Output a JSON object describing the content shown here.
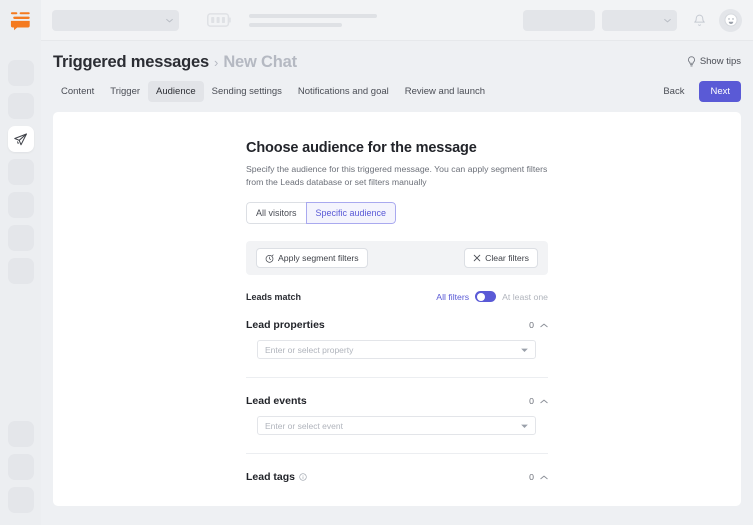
{
  "colors": {
    "accent": "#5a5ad6",
    "brand_orange": "#f47a20",
    "page_bg": "#eef0f3",
    "card_bg": "#ffffff",
    "muted_text": "#b0b4bc"
  },
  "rail": {
    "logo_name": "dashly-logo",
    "items": [
      {
        "name": "sidebar-item-skeleton-1",
        "state": "placeholder"
      },
      {
        "name": "sidebar-item-skeleton-2",
        "state": "placeholder"
      },
      {
        "name": "sidebar-item-triggered-messages",
        "state": "active",
        "icon": "paper-plane-icon"
      },
      {
        "name": "sidebar-item-skeleton-3",
        "state": "placeholder"
      },
      {
        "name": "sidebar-item-skeleton-4",
        "state": "placeholder"
      },
      {
        "name": "sidebar-item-skeleton-5",
        "state": "placeholder"
      },
      {
        "name": "sidebar-item-skeleton-6",
        "state": "placeholder"
      }
    ],
    "bottom_items": [
      {
        "name": "sidebar-bottom-skeleton-1",
        "state": "placeholder"
      },
      {
        "name": "sidebar-bottom-skeleton-2",
        "state": "placeholder"
      },
      {
        "name": "sidebar-bottom-skeleton-3",
        "state": "placeholder"
      }
    ]
  },
  "topbar": {
    "workspace_select": "",
    "battery_icon": "battery-icon",
    "notifications_icon": "bell-icon",
    "avatar_icon": "user-avatar",
    "dropdown_icon": "chevron-down-icon"
  },
  "header": {
    "breadcrumb_parent": "Triggered messages",
    "breadcrumb_separator": "›",
    "breadcrumb_current": "New Chat",
    "show_tips_label": "Show tips",
    "show_tips_icon": "lightbulb-icon"
  },
  "tabs": {
    "items": [
      {
        "label": "Content",
        "active": false
      },
      {
        "label": "Trigger",
        "active": false
      },
      {
        "label": "Audience",
        "active": true
      },
      {
        "label": "Sending settings",
        "active": false
      },
      {
        "label": "Notifications and goal",
        "active": false
      },
      {
        "label": "Review and launch",
        "active": false
      }
    ],
    "back_label": "Back",
    "next_label": "Next"
  },
  "main": {
    "title": "Choose audience for the message",
    "description": "Specify the audience for this triggered message. You can apply segment filters from the Leads database or set filters manually",
    "audience_modes": [
      {
        "label": "All visitors",
        "active": false
      },
      {
        "label": "Specific audience",
        "active": true
      }
    ],
    "filter_bar": {
      "apply_label": "Apply segment filters",
      "apply_icon": "segment-clock-icon",
      "clear_label": "Clear filters",
      "clear_icon": "close-x-icon"
    },
    "leads_match": {
      "label": "Leads match",
      "option_all": "All filters",
      "option_any": "At least one",
      "selected": "All filters"
    },
    "sections": [
      {
        "title": "Lead properties",
        "count": "0",
        "collapse_icon": "chevron-up-icon",
        "has_info": false,
        "input_placeholder": "Enter or select property",
        "input_value": "",
        "has_input": true
      },
      {
        "title": "Lead events",
        "count": "0",
        "collapse_icon": "chevron-up-icon",
        "has_info": false,
        "input_placeholder": "Enter or select event",
        "input_value": "",
        "has_input": true
      },
      {
        "title": "Lead tags",
        "count": "0",
        "collapse_icon": "chevron-up-icon",
        "has_info": true,
        "info_icon": "info-circle-icon",
        "input_placeholder": "",
        "input_value": "",
        "has_input": false
      }
    ]
  }
}
